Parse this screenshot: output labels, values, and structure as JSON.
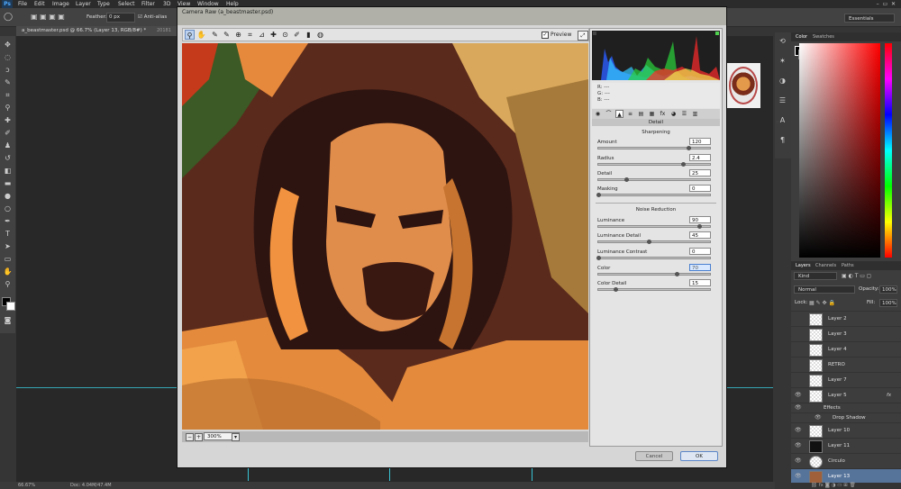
{
  "app": {
    "logo": "Ps",
    "colors": {
      "accent": "#39c4d4",
      "selected_layer": "#56739a"
    }
  },
  "menubar": {
    "items": [
      "File",
      "Edit",
      "Image",
      "Layer",
      "Type",
      "Select",
      "Filter",
      "3D",
      "View",
      "Window",
      "Help"
    ]
  },
  "optbar": {
    "feather_label": "Feather:",
    "feather_value": "0 px",
    "antialias_label": "Anti-alias",
    "workspace": "Essentials"
  },
  "doc_tab": {
    "title": "a_beastmaster.psd @ 66.7% (Layer 13, RGB/8#) *",
    "other_tab": "20181"
  },
  "statusbar": {
    "zoom": "66.67%",
    "doc_size": "Doc: 4.04M/47.4M"
  },
  "color_panel": {
    "tabs": [
      "Color",
      "Swatches"
    ]
  },
  "layers_panel": {
    "tabs": [
      "Layers",
      "Channels",
      "Paths"
    ],
    "filter_kind": "Kind",
    "blend_mode": "Normal",
    "opacity_label": "Opacity:",
    "opacity_value": "100%",
    "lock_label": "Lock:",
    "fill_label": "Fill:",
    "fill_value": "100%",
    "layers": [
      {
        "name": "Layer 2",
        "visible": false
      },
      {
        "name": "Layer 3",
        "visible": false
      },
      {
        "name": "Layer 4",
        "visible": false
      },
      {
        "name": "RETRO",
        "visible": false
      },
      {
        "name": "Layer 7",
        "visible": false
      },
      {
        "name": "Layer 5",
        "visible": true,
        "fx": "fx"
      },
      {
        "name": "Effects",
        "visible": true,
        "sub": true
      },
      {
        "name": "Drop Shadow",
        "visible": true,
        "sub": true
      },
      {
        "name": "Layer 10",
        "visible": true
      },
      {
        "name": "Layer 11",
        "visible": true
      },
      {
        "name": "Circulo",
        "visible": true
      },
      {
        "name": "Layer 13",
        "visible": true,
        "selected": true
      }
    ]
  },
  "dialog": {
    "title": "Camera Raw (a_beastmaster.psd)",
    "preview_label": "Preview",
    "preview_checked": true,
    "zoom_value": "300%",
    "readout": {
      "r": "R:  ---",
      "g": "G:  ---",
      "b": "B:  ---"
    },
    "panel_title": "Detail",
    "sharpening": {
      "title": "Sharpening",
      "sliders": [
        {
          "label": "Amount",
          "value": "120",
          "level": 0.81
        },
        {
          "label": "Radius",
          "value": "2.4",
          "level": 0.76
        },
        {
          "label": "Detail",
          "value": "25",
          "level": 0.25
        },
        {
          "label": "Masking",
          "value": "0",
          "level": 0.0
        }
      ]
    },
    "noise_reduction": {
      "title": "Noise Reduction",
      "sliders": [
        {
          "label": "Luminance",
          "value": "90",
          "level": 0.9
        },
        {
          "label": "Luminance Detail",
          "value": "45",
          "level": 0.45
        },
        {
          "label": "Luminance Contrast",
          "value": "0",
          "level": 0.0
        },
        {
          "label": "Color",
          "value": "70",
          "level": 0.7,
          "focused": true
        },
        {
          "label": "Color Detail",
          "value": "15",
          "level": 0.15
        }
      ]
    },
    "cancel_label": "Cancel",
    "ok_label": "OK"
  }
}
